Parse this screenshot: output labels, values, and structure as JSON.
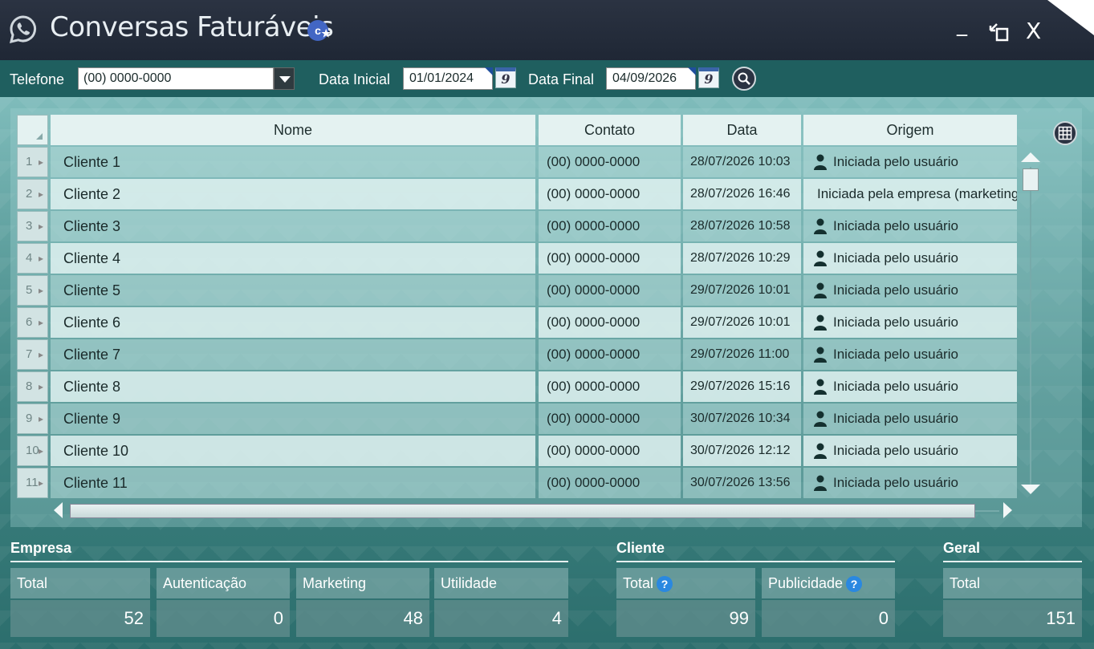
{
  "window": {
    "title": "Conversas Faturáveis",
    "badge_letter": "c",
    "minimize": "_",
    "close": "X",
    "app_icon": "whatsapp-icon"
  },
  "filters": {
    "telefone_label": "Telefone",
    "telefone_value": "(00) 0000-0000",
    "data_inicial_label": "Data Inicial",
    "data_inicial_value": "01/01/2024",
    "data_final_label": "Data Final",
    "data_final_value": "04/09/2026",
    "calendar_day": "9"
  },
  "grid": {
    "columns": [
      "Nome",
      "Contato",
      "Data",
      "Origem"
    ],
    "rows": [
      {
        "n": "1",
        "nome": "Cliente 1",
        "contato": "(00) 0000-0000",
        "data": "28/07/2026 10:03",
        "origem": "Iniciada pelo usuário",
        "icon": true
      },
      {
        "n": "2",
        "nome": "Cliente 2",
        "contato": "(00) 0000-0000",
        "data": "28/07/2026 16:46",
        "origem": "Iniciada pela empresa (marketing)",
        "icon": false
      },
      {
        "n": "3",
        "nome": "Cliente 3",
        "contato": "(00) 0000-0000",
        "data": "28/07/2026 10:58",
        "origem": "Iniciada pelo usuário",
        "icon": true
      },
      {
        "n": "4",
        "nome": "Cliente 4",
        "contato": "(00) 0000-0000",
        "data": "28/07/2026 10:29",
        "origem": "Iniciada pelo usuário",
        "icon": true
      },
      {
        "n": "5",
        "nome": "Cliente 5",
        "contato": "(00) 0000-0000",
        "data": "29/07/2026 10:01",
        "origem": "Iniciada pelo usuário",
        "icon": true
      },
      {
        "n": "6",
        "nome": "Cliente 6",
        "contato": "(00) 0000-0000",
        "data": "29/07/2026 10:01",
        "origem": "Iniciada pelo usuário",
        "icon": true
      },
      {
        "n": "7",
        "nome": "Cliente 7",
        "contato": "(00) 0000-0000",
        "data": "29/07/2026 11:00",
        "origem": "Iniciada pelo usuário",
        "icon": true
      },
      {
        "n": "8",
        "nome": "Cliente 8",
        "contato": "(00) 0000-0000",
        "data": "29/07/2026 15:16",
        "origem": "Iniciada pelo usuário",
        "icon": true
      },
      {
        "n": "9",
        "nome": "Cliente 9",
        "contato": "(00) 0000-0000",
        "data": "30/07/2026 10:34",
        "origem": "Iniciada pelo usuário",
        "icon": true
      },
      {
        "n": "10",
        "nome": "Cliente 10",
        "contato": "(00) 0000-0000",
        "data": "30/07/2026 12:12",
        "origem": "Iniciada pelo usuário",
        "icon": true
      },
      {
        "n": "11",
        "nome": "Cliente 11",
        "contato": "(00) 0000-0000",
        "data": "30/07/2026 13:56",
        "origem": "Iniciada pelo usuário",
        "icon": true
      }
    ]
  },
  "summary": {
    "empresa": {
      "title": "Empresa",
      "items": [
        {
          "label": "Total",
          "value": "52"
        },
        {
          "label": "Autenticação",
          "value": "0"
        },
        {
          "label": "Marketing",
          "value": "48"
        },
        {
          "label": "Utilidade",
          "value": "4"
        }
      ]
    },
    "cliente": {
      "title": "Cliente",
      "items": [
        {
          "label": "Total",
          "value": "99"
        },
        {
          "label": "Publicidade",
          "value": "0"
        }
      ]
    },
    "geral": {
      "title": "Geral",
      "items": [
        {
          "label": "Total",
          "value": "151"
        }
      ]
    },
    "help_mark": "?"
  }
}
